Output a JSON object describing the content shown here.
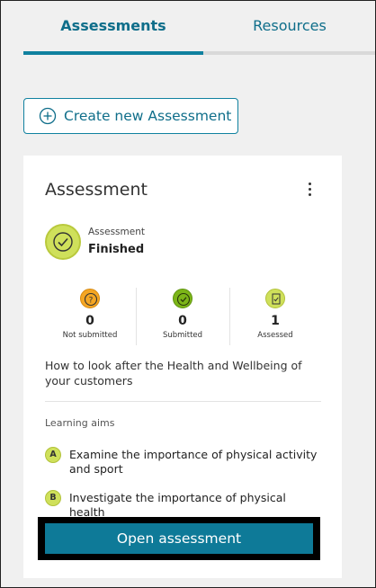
{
  "tabs": [
    {
      "label": "Assessments",
      "active": true
    },
    {
      "label": "Resources",
      "active": false
    }
  ],
  "create_button": {
    "label": "Create new Assessment",
    "icon": "plus-circle-icon"
  },
  "card": {
    "title": "Assessment",
    "menu_icon": "kebab-menu-icon",
    "status": {
      "label": "Assessment",
      "value": "Finished",
      "icon": "check-circle-icon"
    },
    "stats": [
      {
        "value": "0",
        "label": "Not submitted",
        "icon": "question-icon",
        "color": "#f5a623"
      },
      {
        "value": "0",
        "label": "Submitted",
        "icon": "check-icon",
        "color": "#7cb518"
      },
      {
        "value": "1",
        "label": "Assessed",
        "icon": "assessed-doc-icon",
        "color": "#cfe05b"
      }
    ],
    "description": "How to look after the Health and Wellbeing of your customers",
    "aims_heading": "Learning aims",
    "aims": [
      {
        "badge": "A",
        "text": "Examine the importance of physical activity and sport"
      },
      {
        "badge": "B",
        "text": "Investigate the importance of physical health"
      }
    ],
    "open_button": "Open assessment"
  },
  "colors": {
    "accent": "#10819f",
    "status_green": "#cfe05b",
    "background": "#f0f0f0"
  }
}
